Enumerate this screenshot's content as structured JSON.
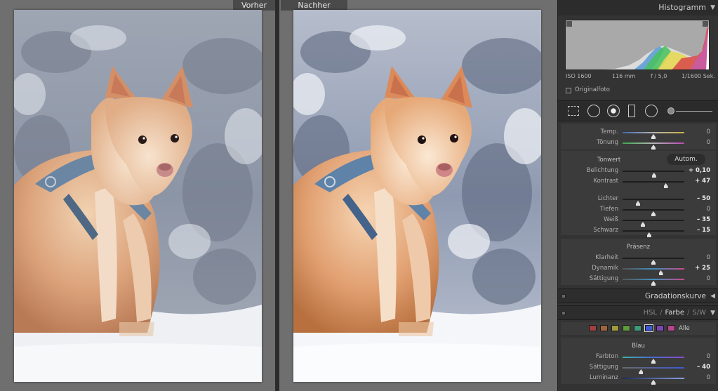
{
  "compare": {
    "before_label": "Vorher",
    "after_label": "Nachher"
  },
  "panel": {
    "histogram": {
      "title": "Histogramm",
      "iso": "ISO 1600",
      "focal": "116 mm",
      "aperture": "f / 5,0",
      "shutter": "1/1600 Sek.",
      "original_label": "Originalfoto"
    },
    "basic": {
      "temp": {
        "label": "Temp.",
        "value": "0",
        "pos": 0.5
      },
      "tint": {
        "label": "Tönung",
        "value": "0",
        "pos": 0.5
      },
      "tone_title": "Tonwert",
      "auto_label": "Autom.",
      "exposure": {
        "label": "Belichtung",
        "value": "+ 0,10",
        "pos": 0.51
      },
      "contrast": {
        "label": "Kontrast",
        "value": "+ 47",
        "pos": 0.7
      },
      "highlights": {
        "label": "Lichter",
        "value": "– 50",
        "pos": 0.25
      },
      "shadows": {
        "label": "Tiefen",
        "value": "0",
        "pos": 0.5
      },
      "whites": {
        "label": "Weiß",
        "value": "– 35",
        "pos": 0.33
      },
      "blacks": {
        "label": "Schwarz",
        "value": "– 15",
        "pos": 0.43
      },
      "presence_title": "Präsenz",
      "clarity": {
        "label": "Klarheit",
        "value": "0",
        "pos": 0.5
      },
      "vibrance": {
        "label": "Dynamik",
        "value": "+ 25",
        "pos": 0.62
      },
      "saturation": {
        "label": "Sättigung",
        "value": "0",
        "pos": 0.5
      }
    },
    "tone_curve_title": "Gradationskurve",
    "hsl": {
      "tab_hsl": "HSL",
      "tab_color": "Farbe",
      "tab_bw": "S/W",
      "all_label": "Alle",
      "swatch_colors": [
        "#a04040",
        "#a0643c",
        "#a09a3c",
        "#5f9a3c",
        "#3c9a7a",
        "#3c5ad2",
        "#7a46b4",
        "#b4468c"
      ],
      "group_title": "Blau",
      "hue": {
        "label": "Farbton",
        "value": "0",
        "pos": 0.5
      },
      "saturation": {
        "label": "Sättigung",
        "value": "– 40",
        "pos": 0.3
      },
      "luminance": {
        "label": "Luminanz",
        "value": "0",
        "pos": 0.5
      }
    }
  }
}
